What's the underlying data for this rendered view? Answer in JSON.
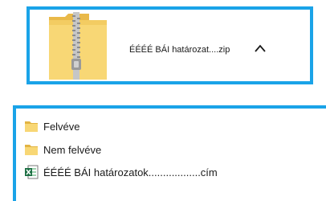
{
  "download": {
    "filename": "ÉÉÉÉ BÁI határozat....zip",
    "file_icon": "zip-folder-icon",
    "toggle_icon": "chevron-up-icon"
  },
  "files": [
    {
      "name": "Felvéve",
      "icon": "folder-icon"
    },
    {
      "name": "Nem felvéve",
      "icon": "folder-icon"
    },
    {
      "name": "ÉÉÉÉ BÁI határozatok..................cím",
      "icon": "excel-file-icon"
    }
  ],
  "colors": {
    "accent_border": "#1aa3e8",
    "folder_yellow": "#f5c952",
    "excel_green": "#1d7044"
  }
}
